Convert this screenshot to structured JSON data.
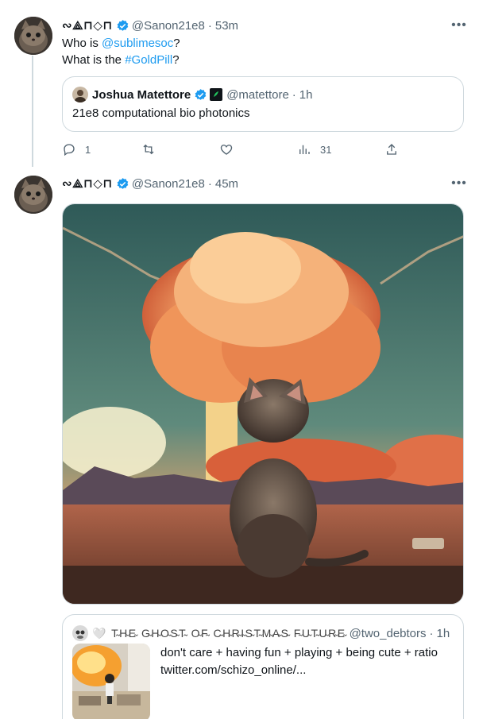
{
  "tweet1": {
    "display_name": "∾⟁⊓◇⊓",
    "handle": "@Sanon21e8",
    "time": "53m",
    "line1_prefix": "Who is ",
    "line1_mention": "@sublimesoc",
    "line1_suffix": "?",
    "line2_prefix": "What is the ",
    "line2_hashtag": "#GoldPill",
    "line2_suffix": "?",
    "more_icon": "more-icon",
    "quote": {
      "name": "Joshua Matettore",
      "handle": "@matettore",
      "time": "1h",
      "text": "21e8 computational bio photonics"
    },
    "actions": {
      "replies": "1",
      "retweets": "",
      "likes": "",
      "views": "31"
    }
  },
  "tweet2": {
    "display_name": "∾⟁⊓◇⊓",
    "handle": "@Sanon21e8",
    "time": "45m",
    "quote": {
      "name": "🤍 T̴H̴E̴ G̴H̴O̴S̴T̴ O̴F̴ C̴H̴R̴I̴S̴T̴M̴A̴S̴ F̴U̴T̴U̴R̴E̴",
      "handle": "@two_debtors",
      "time": "1h",
      "text_line1": "don't care + having fun + playing + being cute + ratio",
      "text_line2": "twitter.com/schizo_online/..."
    }
  },
  "colors": {
    "link": "#1d9bf0",
    "secondary": "#536471",
    "border": "#cfd9de",
    "verified": "#1d9bf0"
  },
  "separator": "·"
}
